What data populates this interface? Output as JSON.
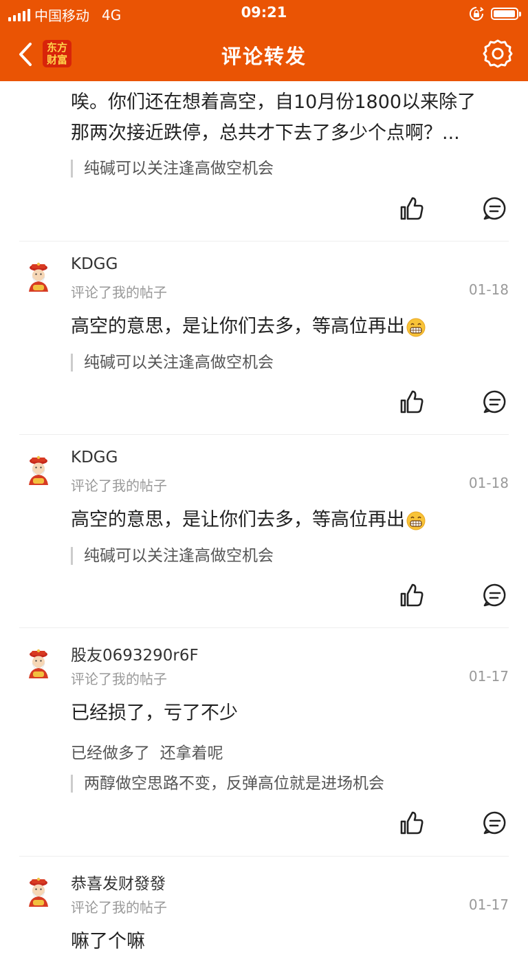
{
  "status_bar": {
    "carrier": "中国移动",
    "network": "4G",
    "time": "09:21"
  },
  "nav": {
    "title": "评论转发",
    "logo_line1": "东方",
    "logo_line2": "财富"
  },
  "icons": {
    "back": "chevron-left-icon",
    "settings": "gear-icon",
    "like": "thumbs-up-icon",
    "reply": "comment-bubble-icon",
    "avatar": "god-of-wealth-avatar",
    "emoji": "grinning-face-emoji"
  },
  "colors": {
    "brand_orange": "#ea5404",
    "text_primary": "#222222",
    "text_secondary": "#999999",
    "quote_bar": "#cccccc"
  },
  "comments": [
    {
      "text_line1": "唉。你们还在想着高空，自10月份1800以来除了",
      "text_line2": "那两次接近跌停，总共才下去了多少个点啊？...",
      "quote": "纯碱可以关注逢高做空机会"
    },
    {
      "username": "KDGG",
      "action": "评论了我的帖子",
      "date": "01-18",
      "text": "高空的意思，是让你们去多，等高位再出",
      "quote": "纯碱可以关注逢高做空机会"
    },
    {
      "username": "KDGG",
      "action": "评论了我的帖子",
      "date": "01-18",
      "text": "高空的意思，是让你们去多，等高位再出",
      "quote": "纯碱可以关注逢高做空机会"
    },
    {
      "username": "股友0693290r6F",
      "action": "评论了我的帖子",
      "date": "01-17",
      "text": "已经损了，亏了不少",
      "subtext": "已经做多了  还拿着呢",
      "quote": "两醇做空思路不变，反弹高位就是进场机会"
    },
    {
      "username": "恭喜发财發發",
      "action": "评论了我的帖子",
      "date": "01-17",
      "text": "嘛了个嘛"
    }
  ]
}
